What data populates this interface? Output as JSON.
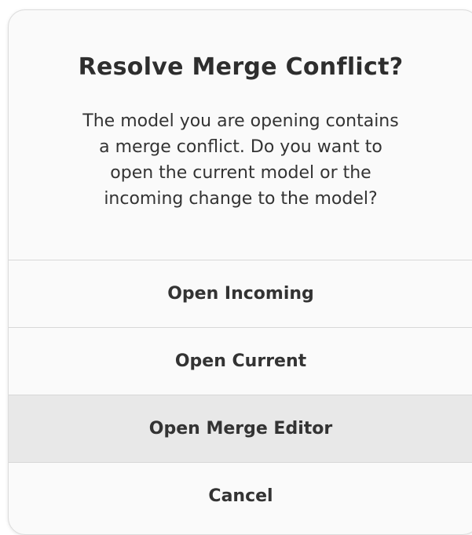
{
  "dialog": {
    "title": "Resolve Merge Conflict?",
    "message_lines": [
      "The model you are opening contains",
      "a merge conflict. Do you want to",
      "open the current model or the",
      "incoming change to the model?"
    ],
    "actions": [
      {
        "label": "Open Incoming"
      },
      {
        "label": "Open Current"
      },
      {
        "label": "Open Merge Editor",
        "highlighted": true
      },
      {
        "label": "Cancel"
      }
    ]
  }
}
